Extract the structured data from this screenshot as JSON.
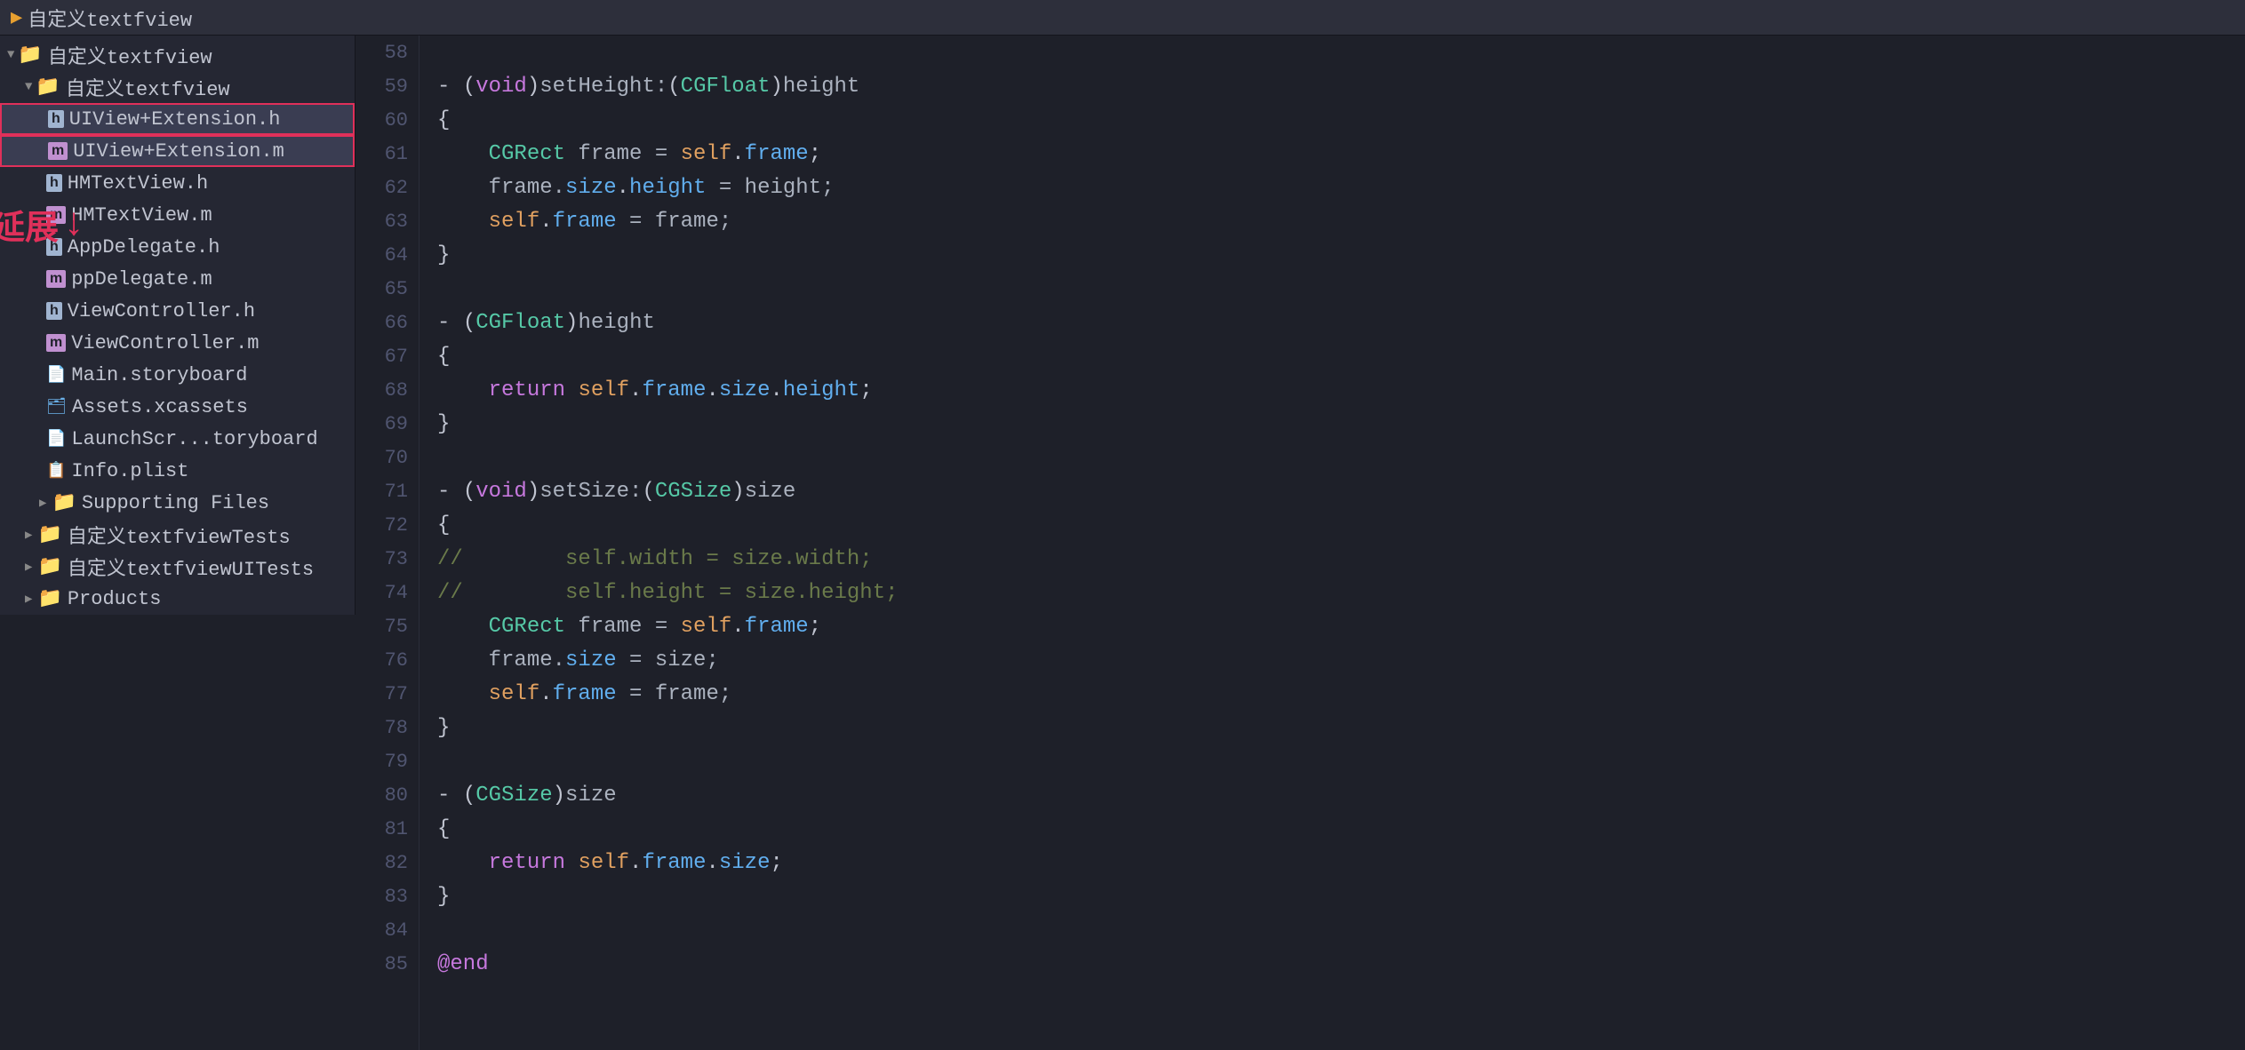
{
  "titleBar": {
    "projectName": "自定义textfview"
  },
  "sidebar": {
    "items": [
      {
        "id": "root-group",
        "label": "自定义textfview",
        "type": "group-open",
        "indent": 0,
        "icon": "folder-open"
      },
      {
        "id": "subgroup",
        "label": "自定义textfview",
        "type": "group-open",
        "indent": 1,
        "icon": "folder-open"
      },
      {
        "id": "uiview-h",
        "label": "UIView+Extension.h",
        "type": "file-h",
        "indent": 2,
        "selected": true
      },
      {
        "id": "uiview-m",
        "label": "UIView+Extension.m",
        "type": "file-m",
        "indent": 2,
        "selected": true
      },
      {
        "id": "hmtextview-h",
        "label": "HMTextView.h",
        "type": "file-h",
        "indent": 2
      },
      {
        "id": "hmtextview-m",
        "label": "HMTextView.m",
        "type": "file-m",
        "indent": 2
      },
      {
        "id": "appdelegate-h",
        "label": "AppDelegate.h",
        "type": "file-h",
        "indent": 2
      },
      {
        "id": "appdelegate-m",
        "label": "ppDelegate.m",
        "type": "file-m",
        "indent": 2,
        "annotation": true
      },
      {
        "id": "viewcontroller-h",
        "label": "ViewController.h",
        "type": "file-h",
        "indent": 2
      },
      {
        "id": "viewcontroller-m",
        "label": "ViewController.m",
        "type": "file-m",
        "indent": 2
      },
      {
        "id": "main-storyboard",
        "label": "Main.storyboard",
        "type": "storyboard",
        "indent": 2
      },
      {
        "id": "assets",
        "label": "Assets.xcassets",
        "type": "assets",
        "indent": 2
      },
      {
        "id": "launch-storyboard",
        "label": "LaunchScr...toryboard",
        "type": "storyboard",
        "indent": 2
      },
      {
        "id": "info-plist",
        "label": "Info.plist",
        "type": "plist",
        "indent": 2
      },
      {
        "id": "supporting",
        "label": "Supporting Files",
        "type": "group-closed",
        "indent": 2
      },
      {
        "id": "tests-group",
        "label": "自定义textfviewTests",
        "type": "group-closed",
        "indent": 1
      },
      {
        "id": "uitests-group",
        "label": "自定义textfviewUITests",
        "type": "group-closed",
        "indent": 1
      },
      {
        "id": "products-group",
        "label": "Products",
        "type": "group-closed",
        "indent": 1
      }
    ]
  },
  "annotation": {
    "text": "延展",
    "arrowSymbol": "↓"
  },
  "codeEditor": {
    "lines": [
      {
        "num": 58,
        "tokens": []
      },
      {
        "num": 59,
        "tokens": [
          {
            "text": "- ",
            "class": "kw-minus"
          },
          {
            "text": "(",
            "class": "kw-paren"
          },
          {
            "text": "void",
            "class": "kw-void"
          },
          {
            "text": ")",
            "class": "kw-paren"
          },
          {
            "text": "setHeight:",
            "class": "kw-plain"
          },
          {
            "text": "(",
            "class": "kw-paren"
          },
          {
            "text": "CGFloat",
            "class": "kw-type"
          },
          {
            "text": ")",
            "class": "kw-paren"
          },
          {
            "text": "height",
            "class": "kw-plain"
          }
        ]
      },
      {
        "num": 60,
        "tokens": [
          {
            "text": "{",
            "class": "kw-brace"
          }
        ]
      },
      {
        "num": 61,
        "tokens": [
          {
            "text": "    ",
            "class": "kw-plain"
          },
          {
            "text": "CGRect",
            "class": "kw-type"
          },
          {
            "text": " frame = ",
            "class": "kw-plain"
          },
          {
            "text": "self",
            "class": "kw-self"
          },
          {
            "text": ".",
            "class": "kw-dot"
          },
          {
            "text": "frame",
            "class": "kw-prop"
          },
          {
            "text": ";",
            "class": "kw-semi"
          }
        ]
      },
      {
        "num": 62,
        "tokens": [
          {
            "text": "    frame.",
            "class": "kw-plain"
          },
          {
            "text": "size",
            "class": "kw-prop"
          },
          {
            "text": ".",
            "class": "kw-dot"
          },
          {
            "text": "height",
            "class": "kw-prop"
          },
          {
            "text": " = height;",
            "class": "kw-plain"
          }
        ]
      },
      {
        "num": 63,
        "tokens": [
          {
            "text": "    ",
            "class": "kw-plain"
          },
          {
            "text": "self",
            "class": "kw-self"
          },
          {
            "text": ".",
            "class": "kw-dot"
          },
          {
            "text": "frame",
            "class": "kw-prop"
          },
          {
            "text": " = frame;",
            "class": "kw-plain"
          }
        ]
      },
      {
        "num": 64,
        "tokens": [
          {
            "text": "}",
            "class": "kw-brace"
          }
        ]
      },
      {
        "num": 65,
        "tokens": []
      },
      {
        "num": 66,
        "tokens": [
          {
            "text": "- ",
            "class": "kw-minus"
          },
          {
            "text": "(",
            "class": "kw-paren"
          },
          {
            "text": "CGFloat",
            "class": "kw-type"
          },
          {
            "text": ")",
            "class": "kw-paren"
          },
          {
            "text": "height",
            "class": "kw-plain"
          }
        ]
      },
      {
        "num": 67,
        "tokens": [
          {
            "text": "{",
            "class": "kw-brace"
          }
        ]
      },
      {
        "num": 68,
        "tokens": [
          {
            "text": "    ",
            "class": "kw-plain"
          },
          {
            "text": "return",
            "class": "kw-return"
          },
          {
            "text": " ",
            "class": "kw-plain"
          },
          {
            "text": "self",
            "class": "kw-self"
          },
          {
            "text": ".",
            "class": "kw-dot"
          },
          {
            "text": "frame",
            "class": "kw-prop"
          },
          {
            "text": ".",
            "class": "kw-dot"
          },
          {
            "text": "size",
            "class": "kw-prop"
          },
          {
            "text": ".",
            "class": "kw-dot"
          },
          {
            "text": "height",
            "class": "kw-prop"
          },
          {
            "text": ";",
            "class": "kw-semi"
          }
        ]
      },
      {
        "num": 69,
        "tokens": [
          {
            "text": "}",
            "class": "kw-brace"
          }
        ]
      },
      {
        "num": 70,
        "tokens": []
      },
      {
        "num": 71,
        "tokens": [
          {
            "text": "- ",
            "class": "kw-minus"
          },
          {
            "text": "(",
            "class": "kw-paren"
          },
          {
            "text": "void",
            "class": "kw-void"
          },
          {
            "text": ")",
            "class": "kw-paren"
          },
          {
            "text": "setSize:",
            "class": "kw-plain"
          },
          {
            "text": "(",
            "class": "kw-paren"
          },
          {
            "text": "CGSize",
            "class": "kw-type"
          },
          {
            "text": ")",
            "class": "kw-paren"
          },
          {
            "text": "size",
            "class": "kw-plain"
          }
        ]
      },
      {
        "num": 72,
        "tokens": [
          {
            "text": "{",
            "class": "kw-brace"
          }
        ]
      },
      {
        "num": 73,
        "tokens": [
          {
            "text": "//    ",
            "class": "kw-comment"
          },
          {
            "text": "    self.width = size.width;",
            "class": "kw-comment"
          }
        ]
      },
      {
        "num": 74,
        "tokens": [
          {
            "text": "//    ",
            "class": "kw-comment"
          },
          {
            "text": "    self.height = size.height;",
            "class": "kw-comment"
          }
        ]
      },
      {
        "num": 75,
        "tokens": [
          {
            "text": "    ",
            "class": "kw-plain"
          },
          {
            "text": "CGRect",
            "class": "kw-type"
          },
          {
            "text": " frame = ",
            "class": "kw-plain"
          },
          {
            "text": "self",
            "class": "kw-self"
          },
          {
            "text": ".",
            "class": "kw-dot"
          },
          {
            "text": "frame",
            "class": "kw-prop"
          },
          {
            "text": ";",
            "class": "kw-semi"
          }
        ]
      },
      {
        "num": 76,
        "tokens": [
          {
            "text": "    frame.",
            "class": "kw-plain"
          },
          {
            "text": "size",
            "class": "kw-prop"
          },
          {
            "text": " = size;",
            "class": "kw-plain"
          }
        ]
      },
      {
        "num": 77,
        "tokens": [
          {
            "text": "    ",
            "class": "kw-plain"
          },
          {
            "text": "self",
            "class": "kw-self"
          },
          {
            "text": ".",
            "class": "kw-dot"
          },
          {
            "text": "frame",
            "class": "kw-prop"
          },
          {
            "text": " = frame;",
            "class": "kw-plain"
          }
        ]
      },
      {
        "num": 78,
        "tokens": [
          {
            "text": "}",
            "class": "kw-brace"
          }
        ]
      },
      {
        "num": 79,
        "tokens": []
      },
      {
        "num": 80,
        "tokens": [
          {
            "text": "- ",
            "class": "kw-minus"
          },
          {
            "text": "(",
            "class": "kw-paren"
          },
          {
            "text": "CGSize",
            "class": "kw-type"
          },
          {
            "text": ")",
            "class": "kw-paren"
          },
          {
            "text": "size",
            "class": "kw-plain"
          }
        ]
      },
      {
        "num": 81,
        "tokens": [
          {
            "text": "{",
            "class": "kw-brace"
          }
        ]
      },
      {
        "num": 82,
        "tokens": [
          {
            "text": "    ",
            "class": "kw-plain"
          },
          {
            "text": "return",
            "class": "kw-return"
          },
          {
            "text": " ",
            "class": "kw-plain"
          },
          {
            "text": "self",
            "class": "kw-self"
          },
          {
            "text": ".",
            "class": "kw-dot"
          },
          {
            "text": "frame",
            "class": "kw-prop"
          },
          {
            "text": ".",
            "class": "kw-dot"
          },
          {
            "text": "size",
            "class": "kw-prop"
          },
          {
            "text": ";",
            "class": "kw-semi"
          }
        ]
      },
      {
        "num": 83,
        "tokens": [
          {
            "text": "}",
            "class": "kw-brace"
          }
        ]
      },
      {
        "num": 84,
        "tokens": []
      },
      {
        "num": 85,
        "tokens": [
          {
            "text": "@end",
            "class": "kw-at"
          }
        ]
      }
    ]
  }
}
